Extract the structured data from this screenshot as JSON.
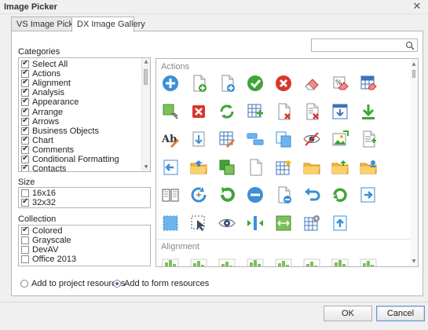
{
  "window": {
    "title": "Image Picker",
    "close_glyph": "✕"
  },
  "tabs": [
    {
      "label": "VS Image Picker",
      "active": false
    },
    {
      "label": "DX Image Gallery",
      "active": true
    }
  ],
  "search": {
    "value": "",
    "placeholder": "",
    "icon": "search-icon"
  },
  "categories": {
    "label": "Categories",
    "items": [
      {
        "label": "Select All",
        "checked": true
      },
      {
        "label": "Actions",
        "checked": true
      },
      {
        "label": "Alignment",
        "checked": true
      },
      {
        "label": "Analysis",
        "checked": true
      },
      {
        "label": "Appearance",
        "checked": true
      },
      {
        "label": "Arrange",
        "checked": true
      },
      {
        "label": "Arrows",
        "checked": true
      },
      {
        "label": "Business Objects",
        "checked": true
      },
      {
        "label": "Chart",
        "checked": true
      },
      {
        "label": "Comments",
        "checked": true
      },
      {
        "label": "Conditional Formatting",
        "checked": true
      },
      {
        "label": "Contacts",
        "checked": true
      }
    ]
  },
  "size": {
    "label": "Size",
    "items": [
      {
        "label": "16x16",
        "checked": false
      },
      {
        "label": "32x32",
        "checked": true
      }
    ]
  },
  "collection": {
    "label": "Collection",
    "items": [
      {
        "label": "Colored",
        "checked": true
      },
      {
        "label": "Grayscale",
        "checked": false
      },
      {
        "label": "DevAV",
        "checked": false
      },
      {
        "label": "Office 2013",
        "checked": false
      }
    ]
  },
  "gallery": {
    "groups": [
      {
        "label": "Actions",
        "icons": [
          "add-icon",
          "new-document-add-icon",
          "add-file-icon",
          "apply-check-icon",
          "cancel-icon",
          "clear-eraser-icon",
          "clear-formatting-icon",
          "clear-table-style-icon",
          "select-crop-icon",
          "delete-icon",
          "refresh-icon",
          "insert-table-icon",
          "delete-document-icon",
          "delete-list-icon",
          "download-window-icon",
          "download-icon",
          "edit-text-icon",
          "export-icon",
          "edit-table-icon",
          "group-icon",
          "copy-icon",
          "hide-icon",
          "insert-picture-icon",
          "document-properties-icon",
          "previous-icon",
          "open-folder-icon",
          "copy-green-icon",
          "new-page-icon",
          "new-table-icon",
          "folder-icon",
          "open-folder-up-icon",
          "folder-user-icon",
          "book-open-icon",
          "reset-icon",
          "redo-icon",
          "remove-icon",
          "save-document-icon",
          "undo-icon",
          "refresh-green-icon",
          "next-icon",
          "select-icon",
          "select-cursor-icon",
          "show-eye-icon",
          "split-icon",
          "stretch-icon",
          "table-settings-icon",
          "upload-icon"
        ]
      },
      {
        "label": "Alignment",
        "icons": [
          "align-top-icon",
          "align-bottom-icon",
          "align-center-icon",
          "align-left-icon",
          "align-middle-icon",
          "align-right-icon",
          "align-horizontal-icon",
          "align-vertical-icon"
        ]
      }
    ]
  },
  "resources": [
    {
      "label": "Add to project resources",
      "selected": false
    },
    {
      "label": "Add to form resources",
      "selected": true
    }
  ],
  "buttons": {
    "ok": "OK",
    "cancel": "Cancel"
  },
  "colors": {
    "accent": "#4a6fb5",
    "panel_border": "#b7b7b7",
    "group_label": "#888888"
  }
}
